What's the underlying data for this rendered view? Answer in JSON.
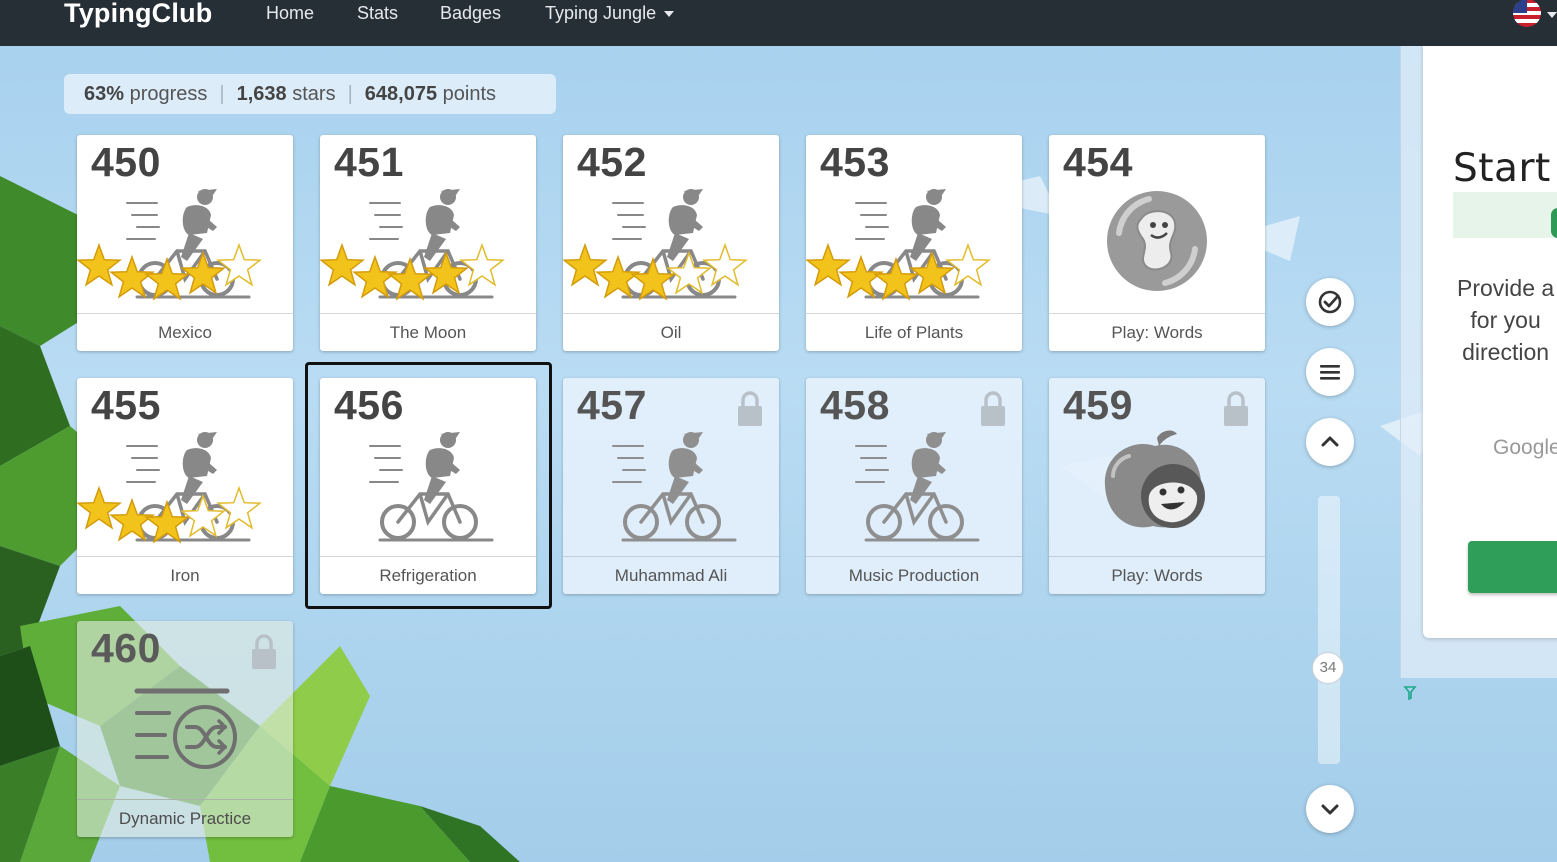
{
  "navbar": {
    "brand": "TypingClub",
    "links": [
      {
        "label": "Home"
      },
      {
        "label": "Stats"
      },
      {
        "label": "Badges"
      },
      {
        "label": "Typing Jungle"
      }
    ]
  },
  "stats": {
    "progress_value": "63%",
    "progress_label": "progress",
    "stars_value": "1,638",
    "stars_label": "stars",
    "points_value": "648,075",
    "points_label": "points"
  },
  "lessons": [
    {
      "number": "450",
      "title": "Mexico",
      "stars": 4,
      "kind": "bike",
      "locked": false
    },
    {
      "number": "451",
      "title": "The Moon",
      "stars": 4,
      "kind": "bike",
      "locked": false
    },
    {
      "number": "452",
      "title": "Oil",
      "stars": 3,
      "kind": "bike",
      "locked": false
    },
    {
      "number": "453",
      "title": "Life of Plants",
      "stars": 4,
      "kind": "bike",
      "locked": false
    },
    {
      "number": "454",
      "title": "Play: Words",
      "stars": 0,
      "kind": "game",
      "locked": false
    },
    {
      "number": "455",
      "title": "Iron",
      "stars": 3,
      "kind": "bike",
      "locked": false
    },
    {
      "number": "456",
      "title": "Refrigeration",
      "stars": 0,
      "kind": "bike",
      "locked": false,
      "selected": true
    },
    {
      "number": "457",
      "title": "Muhammad Ali",
      "stars": 0,
      "kind": "bike",
      "locked": true
    },
    {
      "number": "458",
      "title": "Music Production",
      "stars": 0,
      "kind": "bike",
      "locked": true
    },
    {
      "number": "459",
      "title": "Play: Words",
      "stars": 0,
      "kind": "apple-game",
      "locked": true
    },
    {
      "number": "460",
      "title": "Dynamic Practice",
      "stars": 0,
      "kind": "shuffle",
      "locked": true
    }
  ],
  "scroll": {
    "position_label": "34"
  },
  "right_panel": {
    "title": "Start",
    "line1": "Provide a",
    "line2": "for you",
    "line3": "direction",
    "google": "Google"
  },
  "colors": {
    "navbar": "#262f36",
    "star_gold": "#f2c31b",
    "panel_button": "#2f9e58"
  }
}
